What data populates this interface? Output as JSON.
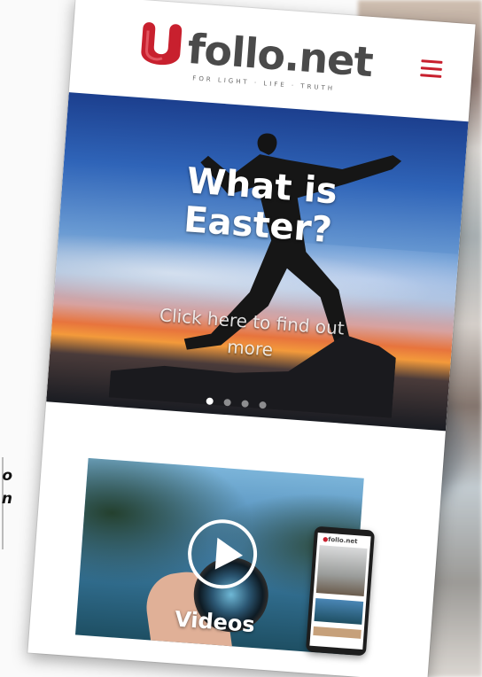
{
  "left_fragment": {
    "line1": "o",
    "line2": "n"
  },
  "header": {
    "logo_text": "follo.net",
    "tagline": "FOR LIGHT · LIFE · TRUTH",
    "menu_icon": "hamburger-menu-icon"
  },
  "hero": {
    "title_line1": "What is",
    "title_line2": "Easter?",
    "link_line1": "Click here to find out",
    "link_line2": "more",
    "slides": 4,
    "active_slide": 1
  },
  "videos": {
    "label": "Videos",
    "icon": "play-icon"
  },
  "mini_phone": {
    "logo_text": "follo.net"
  },
  "colors": {
    "brand_red": "#c8202e",
    "logo_gray": "#4a4a4a"
  }
}
